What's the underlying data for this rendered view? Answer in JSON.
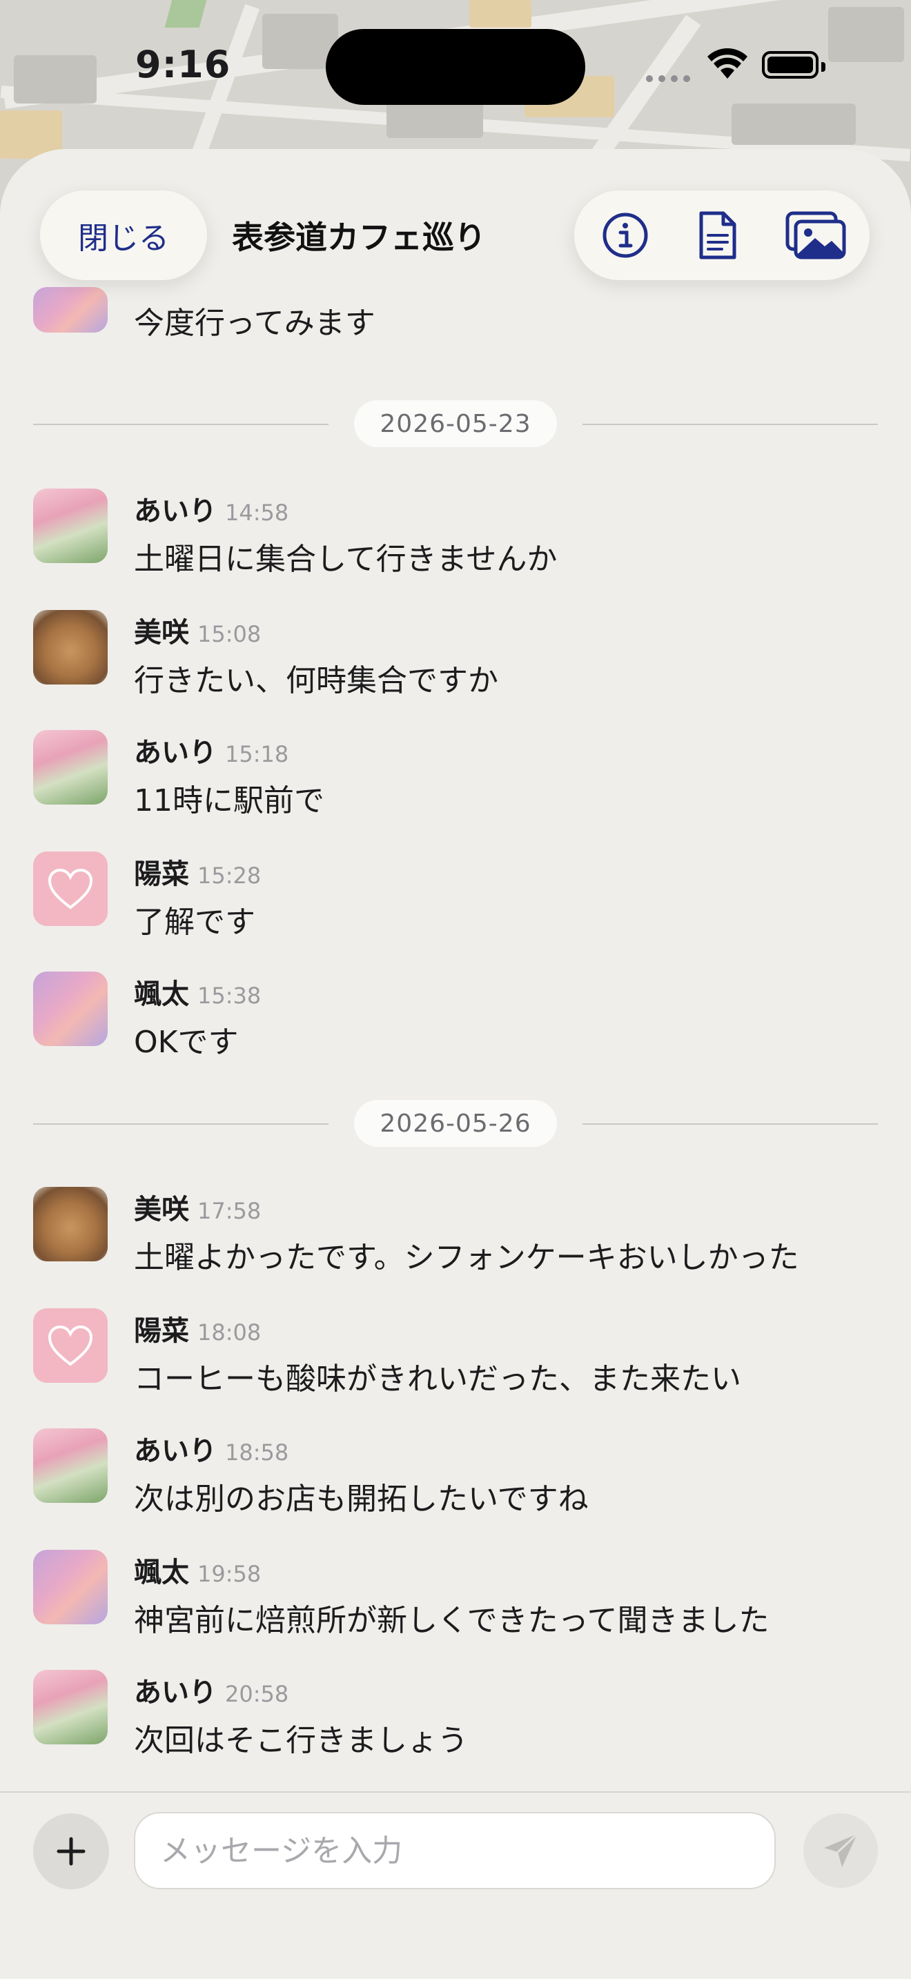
{
  "status": {
    "time": "9:16"
  },
  "header": {
    "close_label": "閉じる",
    "title": "表参道カフェ巡り",
    "actions": [
      "info-icon",
      "document-icon",
      "photos-icon"
    ]
  },
  "messages_top": {
    "partial_text": "今度行ってみます"
  },
  "dates": [
    "2026-05-23",
    "2026-05-26"
  ],
  "messages": [
    {
      "name": "あいり",
      "time": "14:58",
      "text": "土曜日に集合して行きませんか",
      "avatar": "tulip"
    },
    {
      "name": "美咲",
      "time": "15:08",
      "text": "行きたい、何時集合ですか",
      "avatar": "bear"
    },
    {
      "name": "あいり",
      "time": "15:18",
      "text": "11時に駅前で",
      "avatar": "tulip"
    },
    {
      "name": "陽菜",
      "time": "15:28",
      "text": "了解です",
      "avatar": "heart"
    },
    {
      "name": "颯太",
      "time": "15:38",
      "text": "OKです",
      "avatar": "sky"
    },
    {
      "name": "美咲",
      "time": "17:58",
      "text": "土曜よかったです。シフォンケーキおいしかった",
      "avatar": "bear"
    },
    {
      "name": "陽菜",
      "time": "18:08",
      "text": "コーヒーも酸味がきれいだった、また来たい",
      "avatar": "heart"
    },
    {
      "name": "あいり",
      "time": "18:58",
      "text": "次は別のお店も開拓したいですね",
      "avatar": "tulip"
    },
    {
      "name": "颯太",
      "time": "19:58",
      "text": "神宮前に焙煎所が新しくできたって聞きました",
      "avatar": "sky"
    },
    {
      "name": "あいり",
      "time": "20:58",
      "text": "次回はそこ行きましょう",
      "avatar": "tulip"
    }
  ],
  "composer": {
    "placeholder": "メッセージを入力"
  },
  "colors": {
    "accent": "#1f2e8a",
    "background": "#efeeea",
    "heart_avatar": "#f2b7c2"
  }
}
